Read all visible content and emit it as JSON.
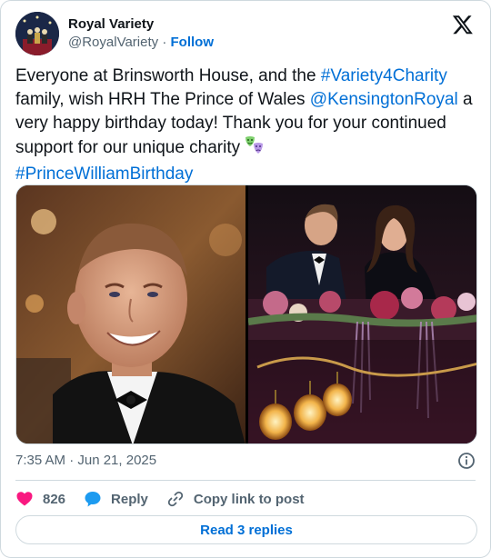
{
  "author": {
    "display_name": "Royal Variety",
    "handle": "@RoyalVariety",
    "separator": " · ",
    "follow_label": "Follow"
  },
  "tweet": {
    "text_part1": "Everyone at Brinsworth House, and the ",
    "hashtag1": "#Variety4Charity",
    "text_part2": " family, wish HRH The Prince of Wales ",
    "mention": "@KensingtonRoyal",
    "text_part3": " a very happy birthday today! Thank you for your continued support for our unique charity ",
    "emoji": "🎭",
    "hashtag2": "#PrinceWilliamBirthday"
  },
  "media": {
    "count": 2
  },
  "meta": {
    "timestamp": "7:35 AM · Jun 21, 2025"
  },
  "actions": {
    "like_count": "826",
    "reply_label": "Reply",
    "copy_label": "Copy link to post"
  },
  "replies_button": {
    "label": "Read 3 replies"
  },
  "colors": {
    "link": "#006fd6",
    "like": "#f91880",
    "reply": "#1d9bf0",
    "text": "#0f1419",
    "secondary": "#536471",
    "border": "#cfd9de"
  }
}
